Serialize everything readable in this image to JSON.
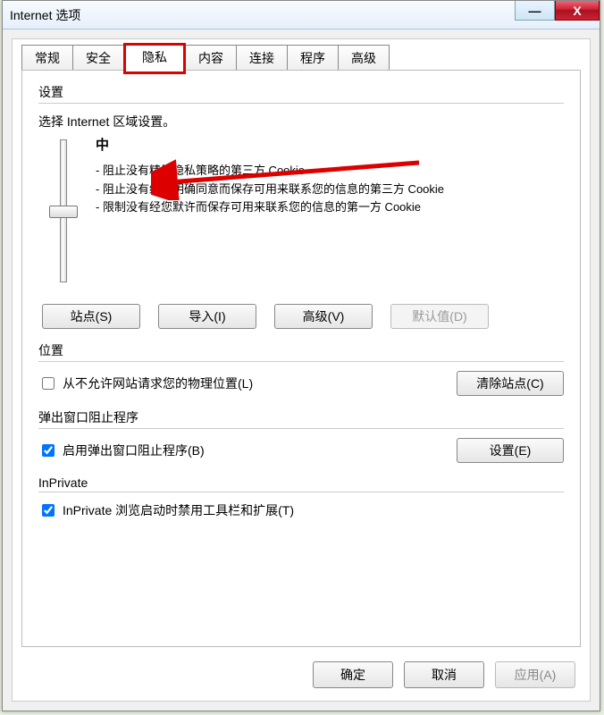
{
  "window": {
    "title": "Internet 选项",
    "min_glyph": "—",
    "close_glyph": "X"
  },
  "tabs": [
    {
      "label": "常规"
    },
    {
      "label": "安全"
    },
    {
      "label": "隐私",
      "active": true
    },
    {
      "label": "内容"
    },
    {
      "label": "连接"
    },
    {
      "label": "程序"
    },
    {
      "label": "高级"
    }
  ],
  "settings": {
    "heading": "设置",
    "instruction": "选择 Internet 区域设置。",
    "level_label": "中",
    "bullets": [
      "- 阻止没有精简隐私策略的第三方 Cookie",
      "- 阻止没有经您明确同意而保存可用来联系您的信息的第三方 Cookie",
      "- 限制没有经您默许而保存可用来联系您的信息的第一方 Cookie"
    ],
    "buttons": {
      "sites": "站点(S)",
      "import": "导入(I)",
      "advanced": "高级(V)",
      "default": "默认值(D)"
    }
  },
  "location": {
    "heading": "位置",
    "checkbox": "从不允许网站请求您的物理位置(L)",
    "checked": false,
    "clear_button": "清除站点(C)"
  },
  "popup": {
    "heading": "弹出窗口阻止程序",
    "checkbox": "启用弹出窗口阻止程序(B)",
    "checked": true,
    "settings_button": "设置(E)"
  },
  "inprivate": {
    "heading": "InPrivate",
    "checkbox": "InPrivate 浏览启动时禁用工具栏和扩展(T)",
    "checked": true
  },
  "footer": {
    "ok": "确定",
    "cancel": "取消",
    "apply": "应用(A)"
  }
}
